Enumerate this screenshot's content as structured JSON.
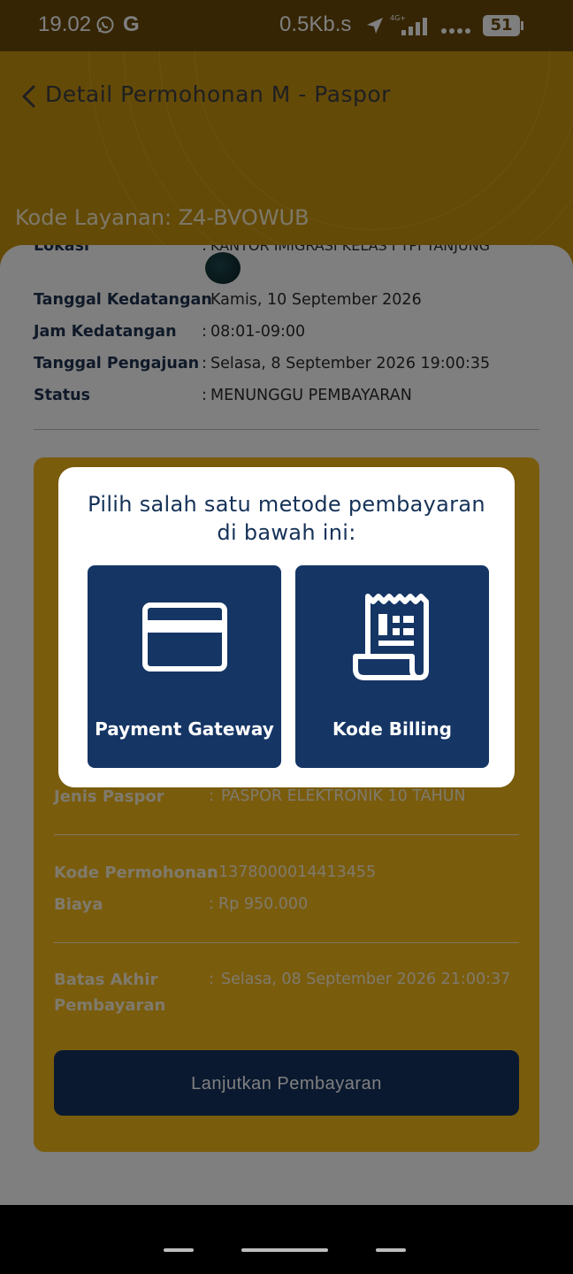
{
  "status_bar": {
    "time": "19.02",
    "speed": "0.5Kb.s",
    "network": "4G+",
    "battery": "51"
  },
  "header": {
    "title": "Detail Permohonan M - Paspor",
    "kode_layanan": "Kode Layanan: Z4-BVOWUB"
  },
  "details": {
    "colon": ":",
    "lokasi_label": "Lokasi",
    "lokasi_value": "KANTOR IMIGRASI KELAS I TPI TANJUNG",
    "tanggal_kedatangan_label": "Tanggal Kedatangan",
    "tanggal_kedatangan_value": "Kamis, 10 September 2026",
    "jam_kedatangan_label": "Jam Kedatangan",
    "jam_kedatangan_value": "08:01-09:00",
    "tanggal_pengajuan_label": "Tanggal Pengajuan",
    "tanggal_pengajuan_value": "Selasa, 8 September 2026 19:00:35",
    "status_label": "Status",
    "status_value": "MENUNGGU PEMBAYARAN"
  },
  "payment_card": {
    "jenis_paspor_label": "Jenis Paspor",
    "jenis_paspor_value": "PASPOR ELEKTRONIK 10 TAHUN",
    "kode_permohonan_label": "Kode Permohonan",
    "kode_permohonan_value": "1378000014413455",
    "biaya_label": "Biaya",
    "biaya_value": "Rp 950.000",
    "batas_akhir_label_line1": "Batas Akhir",
    "batas_akhir_label_line2": "Pembayaran",
    "batas_akhir_value": "Selasa, 08 September 2026 21:00:37",
    "button_label": "Lanjutkan Pembayaran"
  },
  "modal": {
    "title": "Pilih salah satu metode pembayaran di bawah ini:",
    "option_gateway": "Payment Gateway",
    "option_billing": "Kode Billing"
  },
  "colors": {
    "header_gold": "#c9950e",
    "card_gold": "#f5b81a",
    "navy": "#153565",
    "label_blue": "#1f3350"
  }
}
